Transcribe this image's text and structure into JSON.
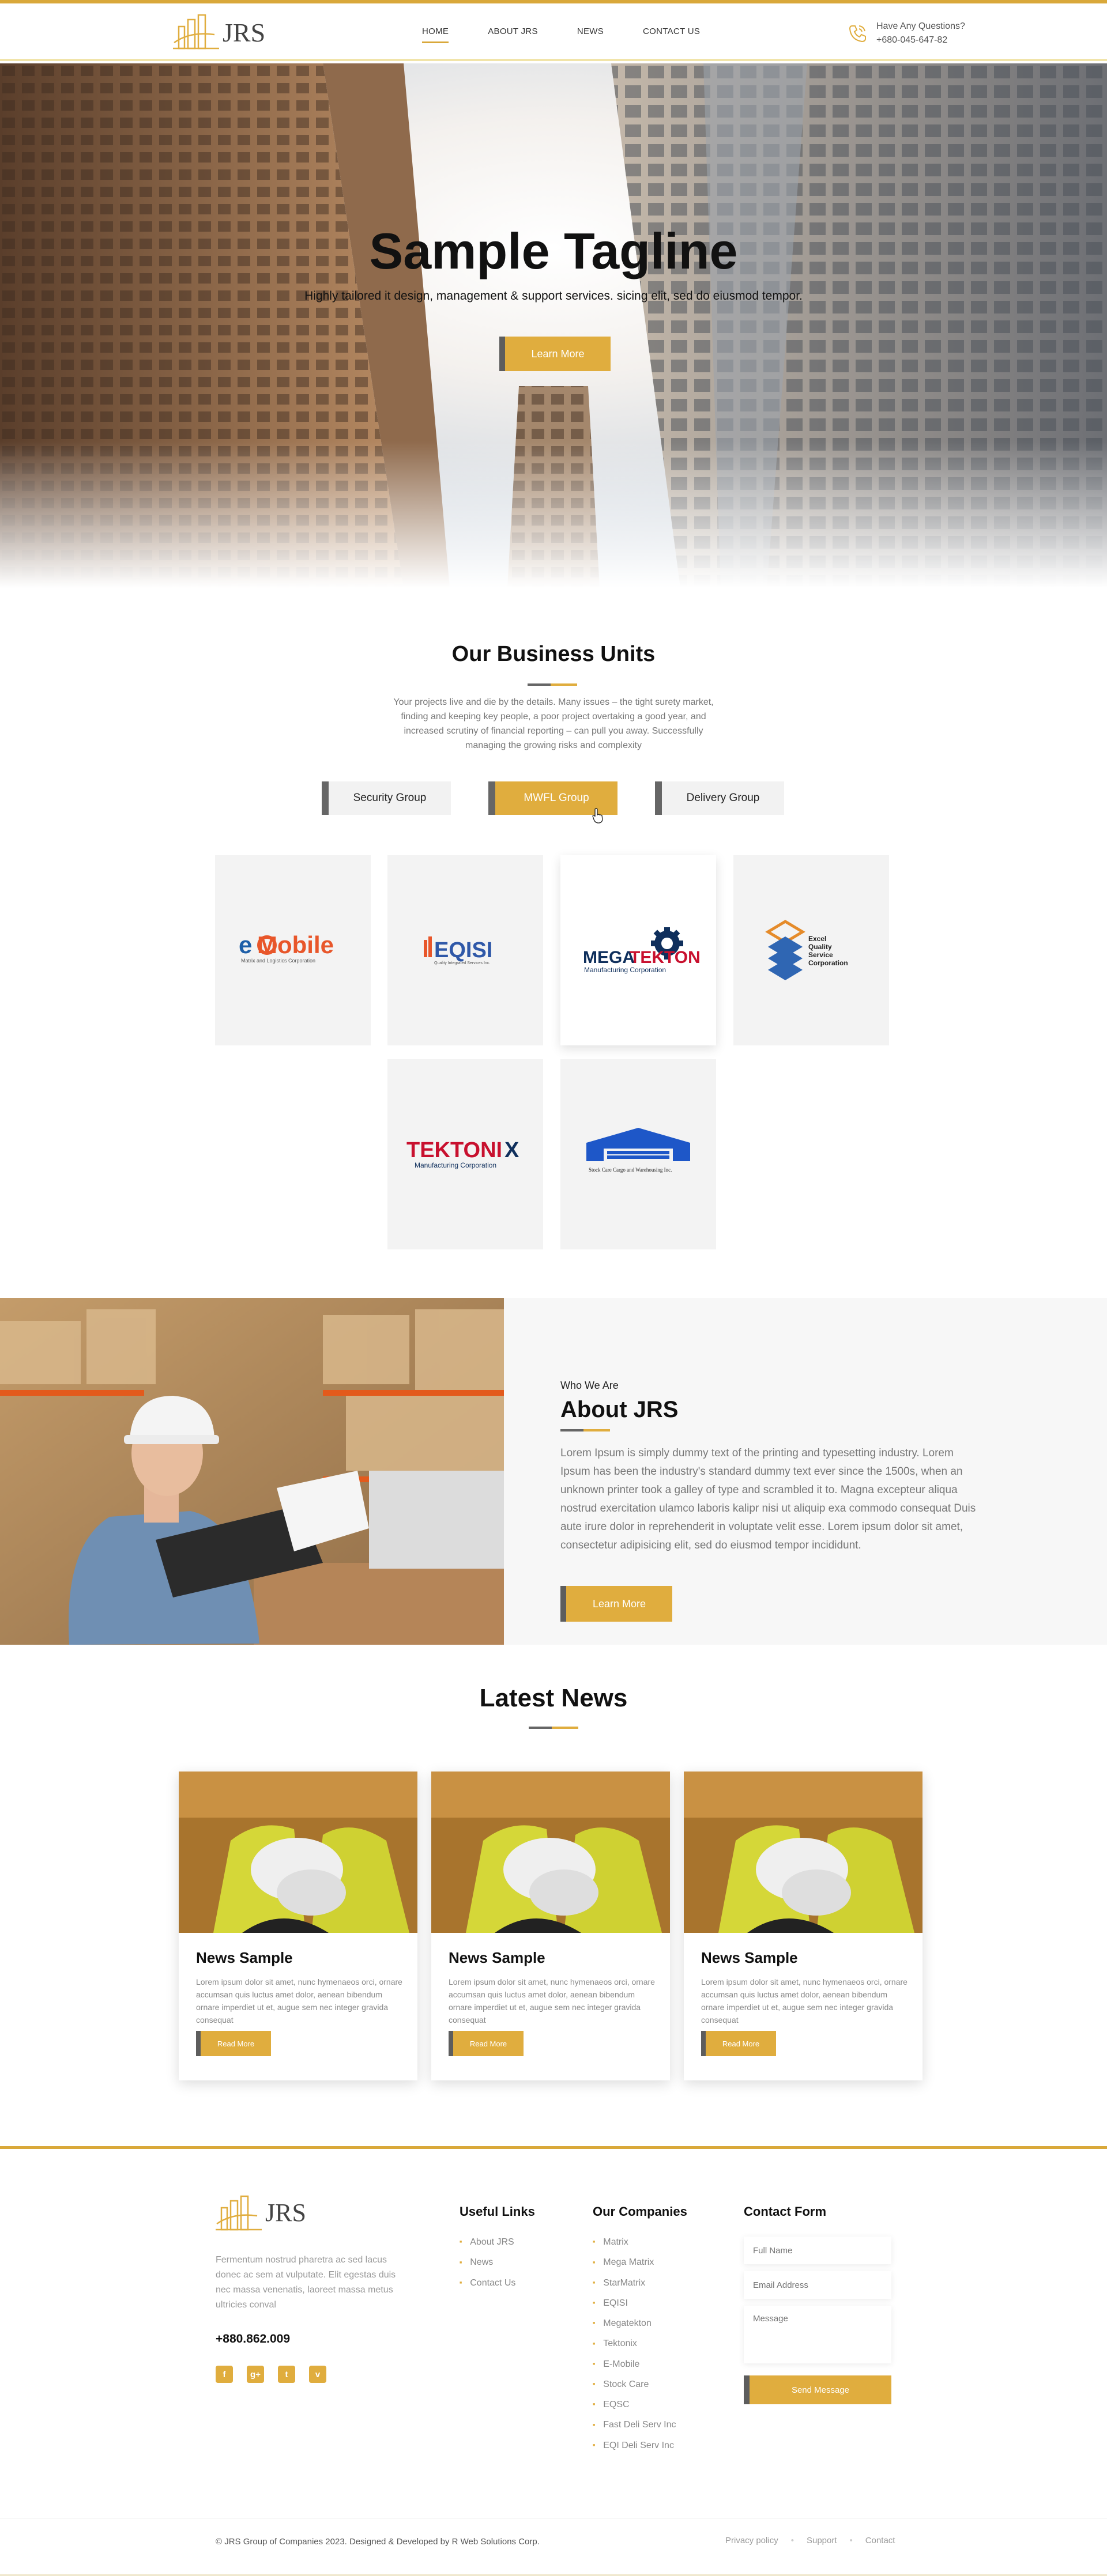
{
  "brand": {
    "name": "JRS",
    "accent": "#e0ad3e",
    "dark": "#5d5d5d"
  },
  "nav": {
    "items": [
      "HOME",
      "ABOUT JRS",
      "NEWS",
      "CONTACT US"
    ],
    "active": "HOME"
  },
  "header_contact": {
    "label": "Have Any Questions?",
    "phone": "+680-045-647-82"
  },
  "hero": {
    "title": "Sample Tagline",
    "subtitle": "Highly tailored it design, management & support services. sicing elit, sed do eiusmod tempor.",
    "button": "Learn More"
  },
  "business_units": {
    "title": "Our Business Units",
    "description": "Your projects live and die by the details. Many issues – the tight surety market, finding and keeping key people, a poor project overtaking a good year, and increased scrutiny of financial reporting – can pull you away. Successfully managing the growing risks and complexity",
    "tabs": [
      "Security Group",
      "MWFL Group",
      "Delivery Group"
    ],
    "active_tab": "MWFL Group",
    "logos": {
      "emobile": {
        "main_e": "e",
        "main_rest": "Mobile",
        "tag": "Matrix and Logistics Corporation"
      },
      "eqisi": {
        "main": "EQISI",
        "tag": "Quality Integrated Services Inc."
      },
      "megatekton": {
        "main_a": "MEGA",
        "main_b": "TEKTON",
        "tag": "Manufacturing Corporation"
      },
      "excel": {
        "l1": "Excel",
        "l2": "Quality",
        "l3": "Service",
        "l4": "Corporation"
      },
      "tektonix": {
        "main_a": "TEKTONI",
        "main_b": "X",
        "tag": "Manufacturing Corporation"
      },
      "stockcare": {
        "tag": "Stock Care Cargo and Warehousing Inc."
      }
    }
  },
  "about": {
    "kicker": "Who We Are",
    "title": "About JRS",
    "body": "Lorem Ipsum is simply dummy text of the printing and typesetting industry. Lorem Ipsum has been the industry's standard dummy text ever since the 1500s, when an unknown printer took a galley of type and scrambled it to. Magna excepteur aliqua nostrud exercitation ulamco laboris kalipr nisi ut aliquip exa commodo consequat Duis aute irure dolor in reprehenderit in voluptate velit esse. Lorem ipsum dolor sit amet, consectetur adipisicing elit, sed do eiusmod tempor incididunt.",
    "button": "Learn More"
  },
  "news": {
    "title": "Latest News",
    "cards": [
      {
        "title": "News Sample",
        "body": "Lorem ipsum dolor sit amet, nunc hymenaeos orci, ornare accumsan quis luctus amet dolor, aenean bibendum ornare imperdiet ut et, augue sem nec integer gravida consequat",
        "button": "Read More"
      },
      {
        "title": "News Sample",
        "body": "Lorem ipsum dolor sit amet, nunc hymenaeos orci, ornare accumsan quis luctus amet dolor, aenean bibendum ornare imperdiet ut et, augue sem nec integer gravida consequat",
        "button": "Read More"
      },
      {
        "title": "News Sample",
        "body": "Lorem ipsum dolor sit amet, nunc hymenaeos orci, ornare accumsan quis luctus amet dolor, aenean bibendum ornare imperdiet ut et, augue sem nec integer gravida consequat",
        "button": "Read More"
      }
    ]
  },
  "footer": {
    "about": "Fermentum nostrud pharetra ac sed lacus donec ac sem at vulputate. Elit egestas duis nec massa venenatis, laoreet massa metus ultricies conval",
    "phone": "+880.862.009",
    "socials": [
      "f",
      "g+",
      "t",
      "v"
    ],
    "social_icons": [
      "facebook-icon",
      "google-plus-icon",
      "twitter-icon",
      "vimeo-icon"
    ],
    "useful_links": {
      "title": "Useful Links",
      "items": [
        "About JRS",
        "News",
        "Contact Us"
      ]
    },
    "companies": {
      "title": "Our Companies",
      "items": [
        "Matrix",
        "Mega Matrix",
        "StarMatrix",
        "EQISI",
        "Megatekton",
        "Tektonix",
        "E-Mobile",
        "Stock Care",
        "EQSC",
        "Fast Deli Serv Inc",
        "EQI Deli Serv Inc"
      ]
    },
    "form": {
      "title": "Contact Form",
      "name_placeholder": "Full Name",
      "email_placeholder": "Email Address",
      "message_placeholder": "Message",
      "button": "Send Message"
    },
    "copyright": "© JRS Group of Companies 2023. Designed & Developed by R Web Solutions Corp.",
    "legal": [
      "Privacy policy",
      "Support",
      "Contact"
    ]
  }
}
